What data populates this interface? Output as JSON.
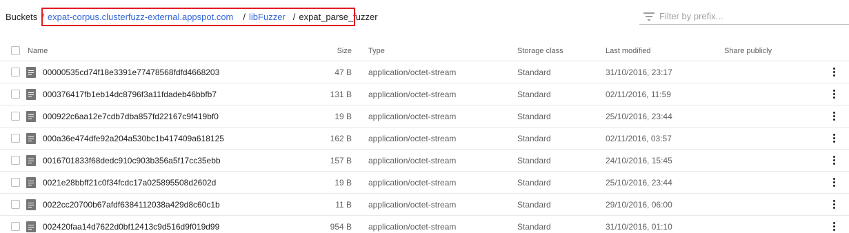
{
  "breadcrumb": {
    "root": "Buckets",
    "separator": "/",
    "bucket": "expat-corpus.clusterfuzz-external.appspot.com",
    "folder": "libFuzzer",
    "current": "expat_parse_fuzzer"
  },
  "filter": {
    "placeholder": "Filter by prefix..."
  },
  "columns": {
    "name": "Name",
    "size": "Size",
    "type": "Type",
    "storage_class": "Storage class",
    "last_modified": "Last modified",
    "share_publicly": "Share publicly"
  },
  "rows": [
    {
      "name": "00000535cd74f18e3391e77478568fdfd4668203",
      "size": "47 B",
      "type": "application/octet-stream",
      "storage_class": "Standard",
      "last_modified": "31/10/2016, 23:17"
    },
    {
      "name": "000376417fb1eb14dc8796f3a11fdadeb46bbfb7",
      "size": "131 B",
      "type": "application/octet-stream",
      "storage_class": "Standard",
      "last_modified": "02/11/2016, 11:59"
    },
    {
      "name": "000922c6aa12e7cdb7dba857fd22167c9f419bf0",
      "size": "19 B",
      "type": "application/octet-stream",
      "storage_class": "Standard",
      "last_modified": "25/10/2016, 23:44"
    },
    {
      "name": "000a36e474dfe92a204a530bc1b417409a618125",
      "size": "162 B",
      "type": "application/octet-stream",
      "storage_class": "Standard",
      "last_modified": "02/11/2016, 03:57"
    },
    {
      "name": "0016701833f68dedc910c903b356a5f17cc35ebb",
      "size": "157 B",
      "type": "application/octet-stream",
      "storage_class": "Standard",
      "last_modified": "24/10/2016, 15:45"
    },
    {
      "name": "0021e28bbff21c0f34fcdc17a025895508d2602d",
      "size": "19 B",
      "type": "application/octet-stream",
      "storage_class": "Standard",
      "last_modified": "25/10/2016, 23:44"
    },
    {
      "name": "0022cc20700b67afdf6384112038a429d8c60c1b",
      "size": "11 B",
      "type": "application/octet-stream",
      "storage_class": "Standard",
      "last_modified": "29/10/2016, 06:00"
    },
    {
      "name": "002420faa14d7622d0bf12413c9d516d9f019d99",
      "size": "954 B",
      "type": "application/octet-stream",
      "storage_class": "Standard",
      "last_modified": "31/10/2016, 01:10"
    }
  ],
  "icons": {
    "filter": "filter-icon",
    "file": "file-icon",
    "row_menu": "more-vert-icon"
  },
  "colors": {
    "link": "#3367d6",
    "highlight": "#e01b24"
  }
}
